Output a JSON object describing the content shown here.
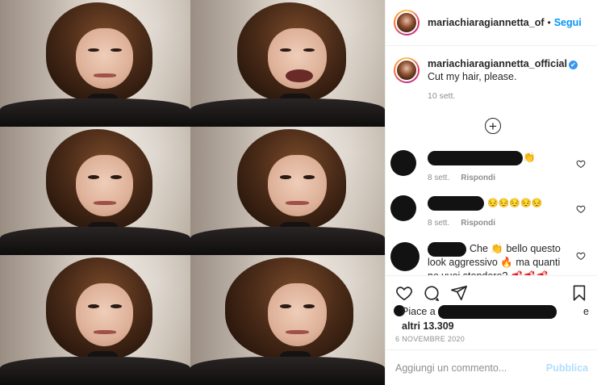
{
  "post": {
    "username": "mariachiaragiannetta_of",
    "dot": "•",
    "follow_label": "Segui"
  },
  "caption": {
    "username": "mariachiaragiannetta_official",
    "verified_icon": "✔",
    "text": "Cut my hair, please.",
    "time": "10 sett."
  },
  "load_more_icon": "⊕",
  "comments": [
    {
      "text_suffix": "👏",
      "time": "8 sett.",
      "reply_label": "Rispondi"
    },
    {
      "text_suffix": "😔😔😔😔😔",
      "time": "8 sett.",
      "reply_label": "Rispondi"
    },
    {
      "text": "Che 👏 bello questo look aggressivo 🔥 ma quanti ne vuoi stendere? 🥩🥩🥩"
    }
  ],
  "likes": {
    "prefix": "Piace a",
    "suffix": "e",
    "count": "altri 13.309"
  },
  "date": "6 NOVEMBRE 2020",
  "add_comment": {
    "placeholder": "Aggiungi un commento...",
    "publish_label": "Pubblica"
  },
  "colors": {
    "accent": "#0095f6",
    "muted": "#8e8e8e",
    "publish_disabled": "#b2dffc"
  }
}
